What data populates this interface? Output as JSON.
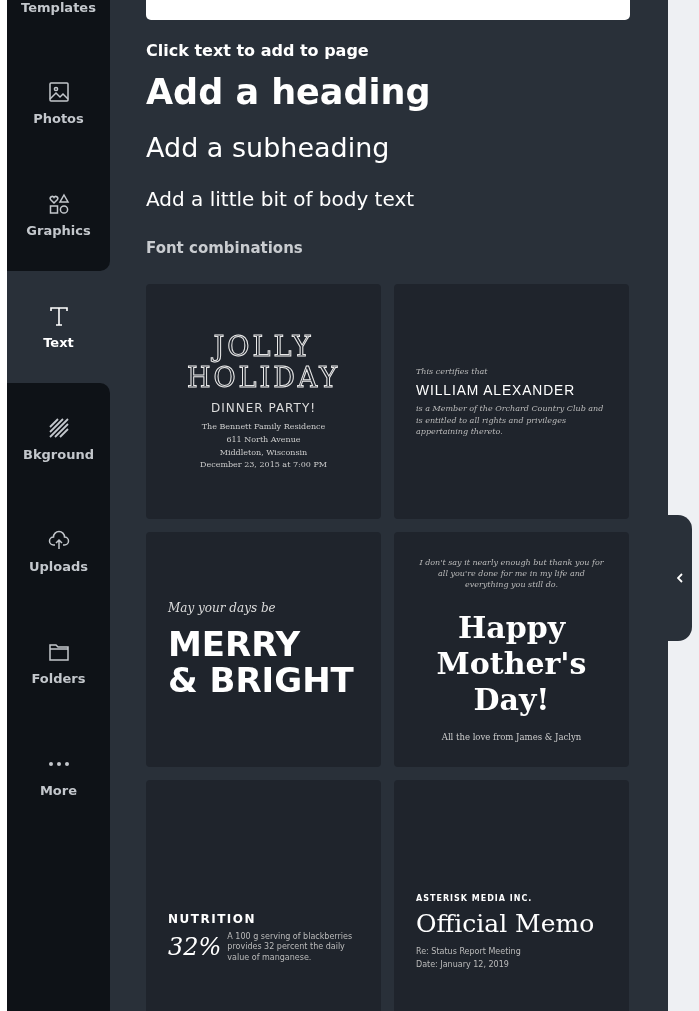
{
  "sidebar": {
    "items": [
      {
        "kind": "templates",
        "label": "Templates",
        "selected": false
      },
      {
        "kind": "photos",
        "label": "Photos",
        "selected": false
      },
      {
        "kind": "graphics",
        "label": "Graphics",
        "selected": false
      },
      {
        "kind": "text",
        "label": "Text",
        "selected": true
      },
      {
        "kind": "background",
        "label": "Bkground",
        "selected": false
      },
      {
        "kind": "uploads",
        "label": "Uploads",
        "selected": false
      },
      {
        "kind": "folders",
        "label": "Folders",
        "selected": false
      },
      {
        "kind": "more",
        "label": "More",
        "selected": false
      }
    ]
  },
  "panel": {
    "intro": "Click text to add to page",
    "heading": "Add a heading",
    "subheading": "Add a subheading",
    "body": "Add a little bit of body text",
    "section_title": "Font combinations",
    "cards": [
      {
        "kind": "center",
        "lines": [
          {
            "kind": "outline",
            "text": "JOLLY"
          },
          {
            "kind": "outline",
            "text": "HOLIDAY"
          },
          {
            "kind": "caps",
            "text": "DINNER PARTY!"
          },
          {
            "kind": "slab",
            "text": "The Bennett Family Residence"
          },
          {
            "kind": "slab",
            "text": "611 North Avenue"
          },
          {
            "kind": "slab",
            "text": "Middleton, Wisconsin"
          },
          {
            "kind": "slab",
            "text": "December 23, 2015 at 7:00 PM"
          }
        ]
      },
      {
        "kind": "left",
        "lines": [
          {
            "kind": "tiny",
            "text": "This certifies that"
          },
          {
            "kind": "condensed",
            "text": "WILLIAM ALEXANDER"
          },
          {
            "kind": "tiny",
            "text": "is a Member of the Orchard Country Club and is entitled to all rights and privileges appertaining thereto."
          }
        ]
      },
      {
        "kind": "left",
        "lines": [
          {
            "kind": "script",
            "text": "May your days be"
          },
          {
            "kind": "bold",
            "text": "MERRY"
          },
          {
            "kind": "bold",
            "text": "& BRIGHT"
          }
        ]
      },
      {
        "kind": "center",
        "lines": [
          {
            "kind": "tiny",
            "text": "I don't say it nearly enough but thank you for all you're done for me in my life and everything you still do."
          },
          {
            "kind": "display",
            "text": "Happy"
          },
          {
            "kind": "display",
            "text": "Mother's"
          },
          {
            "kind": "display",
            "text": "Day!"
          },
          {
            "kind": "serif",
            "text": "All the love from James & Jaclyn"
          }
        ]
      },
      {
        "kind": "left",
        "lines": [
          {
            "kind": "label",
            "text": "NUTRITION"
          },
          {
            "kind": "stat",
            "text": "32%",
            "note": "A 100 g serving of blackberries provides 32 percent the daily value of manganese."
          }
        ]
      },
      {
        "kind": "left",
        "lines": [
          {
            "kind": "label-small",
            "text": "ASTERISK MEDIA INC."
          },
          {
            "kind": "memo",
            "text": "Official Memo"
          },
          {
            "kind": "note",
            "text": "Re: Status Report Meeting"
          },
          {
            "kind": "note",
            "text": "Date: January 12, 2019"
          }
        ]
      }
    ]
  }
}
